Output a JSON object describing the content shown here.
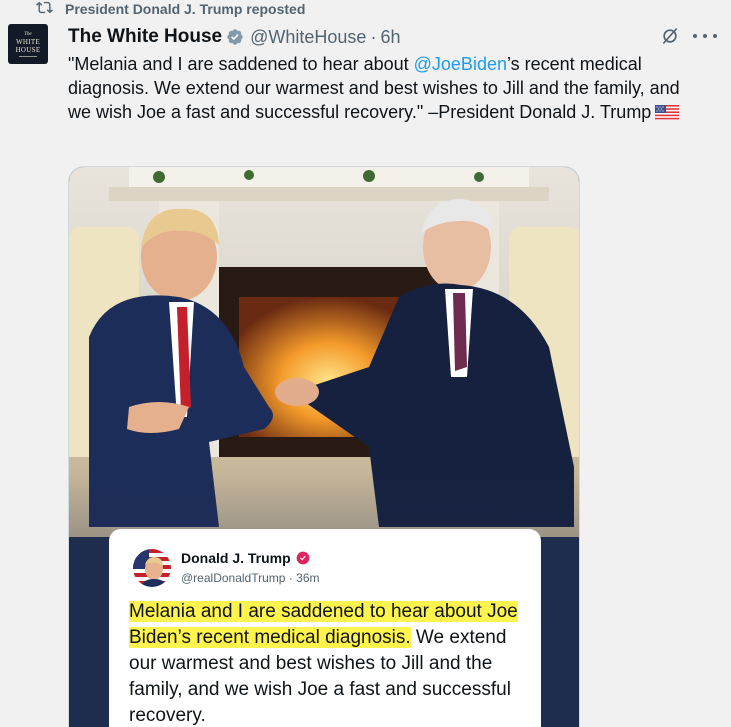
{
  "repost": {
    "label": "President Donald J. Trump reposted"
  },
  "author": {
    "name": "The White House",
    "handle": "@WhiteHouse",
    "separator": "·",
    "time": "6h",
    "avatar_text_the": "The",
    "avatar_text_name_1": "WHITE",
    "avatar_text_name_2": "HOUSE"
  },
  "tweet": {
    "text_before": "\"Melania and I are saddened to hear about ",
    "mention": "@JoeBiden",
    "text_after": "’s recent medical diagnosis. We extend our warmest and best wishes to Jill and the family, and we wish Joe a fast and successful recovery.\" –President Donald J. Trump",
    "emoji": "us-flag-emoji"
  },
  "quote": {
    "name": "Donald J. Trump",
    "handle": "@realDonaldTrump",
    "separator": "·",
    "time": "36m",
    "highlighted": "Melania and I are saddened to hear about Joe Biden’s recent medical diagnosis.",
    "rest": " We extend our warmest and best wishes to Jill and the family, and we wish Joe a fast and successful recovery."
  },
  "colors": {
    "accent": "#1d9bf0",
    "muted": "#536471",
    "highlight": "#fff34d",
    "background": "#f1f1f1"
  },
  "icons": [
    "repost-icon",
    "verified-badge-icon",
    "grok-icon",
    "more-icon",
    "us-flag-emoji",
    "quote-verified-icon"
  ]
}
